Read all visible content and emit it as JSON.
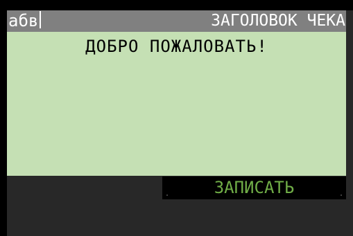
{
  "header": {
    "input_text": "абв",
    "title": "ЗАГОЛОВОК ЧЕКА"
  },
  "display": {
    "message": "ДОБРО ПОЖАЛОВАТЬ!"
  },
  "actions": {
    "record_label": "ЗАПИСАТЬ"
  },
  "colors": {
    "background": "#000000",
    "panel": "#282828",
    "header": "#808080",
    "display": "#c5e0b4",
    "button_text": "#70ad47"
  }
}
